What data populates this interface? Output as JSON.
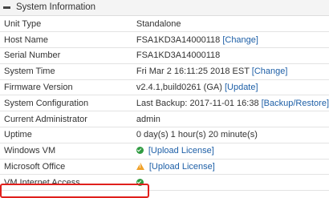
{
  "panel": {
    "title": "System Information"
  },
  "rows": [
    {
      "key": "Unit Type",
      "value": "Standalone"
    },
    {
      "key": "Host Name",
      "value": "FSA1KD3A14000118",
      "link": "[Change]"
    },
    {
      "key": "Serial Number",
      "value": "FSA1KD3A14000118"
    },
    {
      "key": "System Time",
      "value": "Fri Mar 2 16:11:25 2018 EST",
      "link": "[Change]"
    },
    {
      "key": "Firmware Version",
      "value": "v2.4.1,build0261 (GA)",
      "link": "[Update]"
    },
    {
      "key": "System Configuration",
      "value": "Last Backup: 2017-11-01 16:38",
      "link": "[Backup/Restore]"
    },
    {
      "key": "Current Administrator",
      "value": "admin"
    },
    {
      "key": "Uptime",
      "value": "0 day(s) 1 hour(s) 20 minute(s)"
    },
    {
      "key": "Windows VM",
      "icon": "check-circle-icon",
      "link": "[Upload License]"
    },
    {
      "key": "Microsoft Office",
      "icon": "warning-triangle-icon",
      "link": "[Upload License]"
    },
    {
      "key": "VM Internet Access",
      "icon": "check-circle-icon"
    }
  ],
  "colors": {
    "link": "#1d5fa7",
    "ok": "#2f9b41",
    "warning": "#f0a22b",
    "highlight": "#e0201c"
  }
}
